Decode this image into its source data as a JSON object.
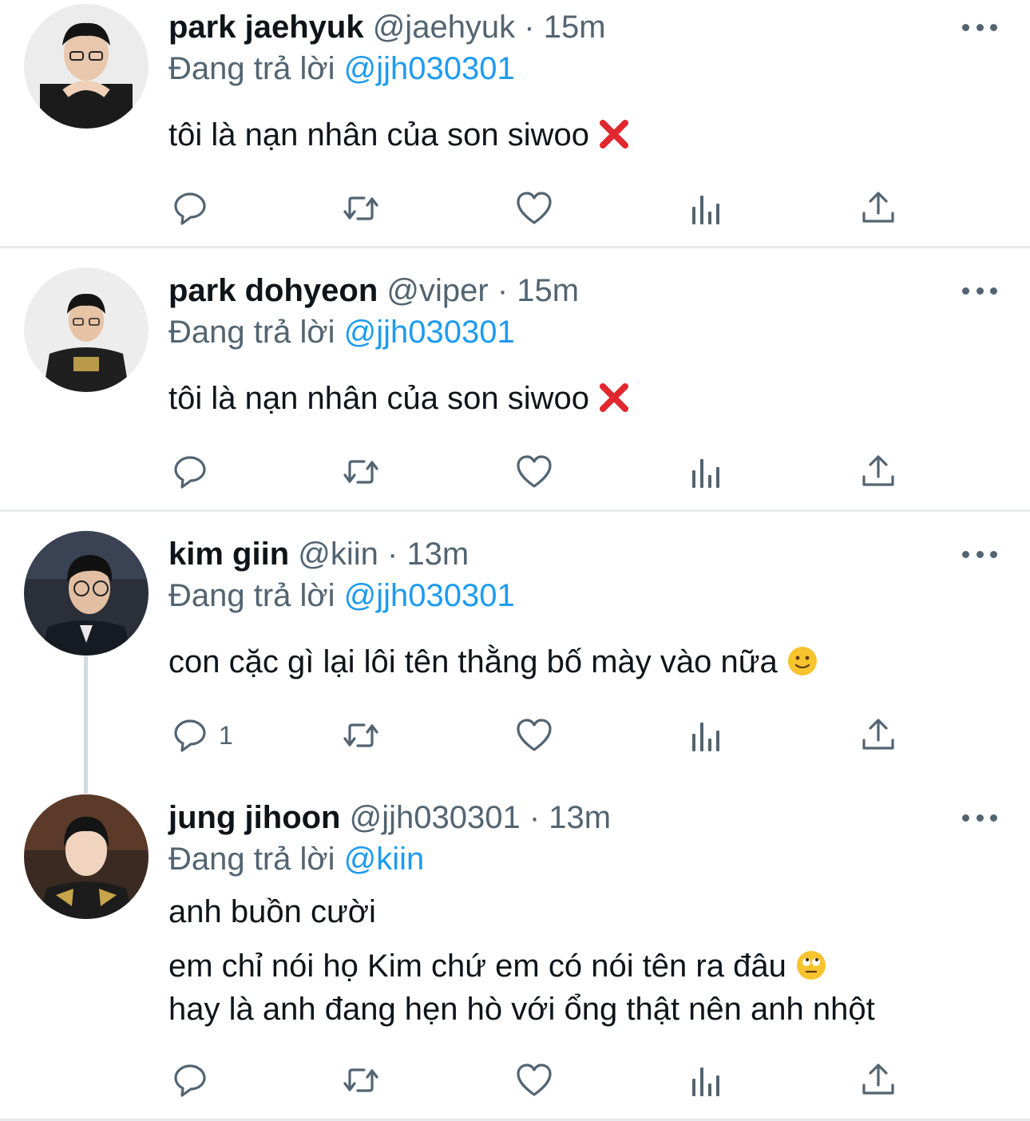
{
  "tweets": [
    {
      "name": "park jaehyuk",
      "handle": "@jaehyuk",
      "time": "15m",
      "replying_prefix": "Đang trả lời",
      "replying_to": "@jjh030301",
      "lines": [
        "tôi là nạn nhân của son siwoo"
      ],
      "emoji": "cross-mark-emoji",
      "reply_count": ""
    },
    {
      "name": "park dohyeon",
      "handle": "@viper",
      "time": "15m",
      "replying_prefix": "Đang trả lời",
      "replying_to": "@jjh030301",
      "lines": [
        "tôi là nạn nhân của son siwoo"
      ],
      "emoji": "cross-mark-emoji",
      "reply_count": ""
    },
    {
      "name": "kim giin",
      "handle": "@kiin",
      "time": "13m",
      "replying_prefix": "Đang trả lời",
      "replying_to": "@jjh030301",
      "lines": [
        "con cặc gì lại lôi tên thằng bố mày vào nữa"
      ],
      "emoji": "slightly-smiling-face-emoji",
      "reply_count": "1"
    },
    {
      "name": "jung jihoon",
      "handle": "@jjh030301",
      "time": "13m",
      "replying_prefix": "Đang trả lời",
      "replying_to": "@kiin",
      "lines": [
        "anh buồn cười",
        "em chỉ nói họ Kim chứ em có nói tên ra đâu",
        "hay là anh đang hẹn hò với ổng thật nên anh nhột"
      ],
      "emoji": "face-with-rolling-eyes-emoji",
      "reply_count": ""
    }
  ],
  "separator": " · ",
  "icons": [
    "reply-icon",
    "retweet-icon",
    "like-icon",
    "analytics-icon",
    "share-icon",
    "more-icon"
  ],
  "colors": {
    "accent": "#1d9bf0",
    "secondary_text": "#536471",
    "emoji_red": "#e0282e",
    "emoji_yellow": "#f7c32e"
  }
}
